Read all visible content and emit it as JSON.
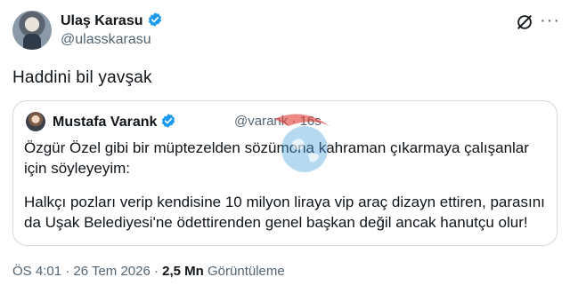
{
  "author": {
    "name": "Ulaş Karasu",
    "handle": "@ulasskarasu"
  },
  "tweet": {
    "text": "Haddini bil yavşak"
  },
  "quoted": {
    "name": "Mustafa Varank",
    "handle": "@varank · 16s",
    "paragraph1": "Özgür Özel gibi bir müptezelden sözümona kahraman çıkarmaya çalışanlar için söyleyeyim:",
    "paragraph2": "Halkçı pozları verip kendisine 10 milyon liraya vip araç dizayn ettiren, parasını da Uşak Belediyesi'ne ödettirenden genel başkan değil ancak hanutçu olur!"
  },
  "meta": {
    "timestamp": "ÖS 4:01 · 26 Tem 2026 · ",
    "views_count": "2,5 Mn",
    "views_label": " Görüntüleme"
  },
  "icons": {
    "verified": "verified-badge-icon",
    "grok": "grok-icon",
    "more": "more-icon"
  },
  "colors": {
    "verified": "#1d9bf0",
    "secondary_text": "#536471",
    "border": "#cfd9de"
  }
}
